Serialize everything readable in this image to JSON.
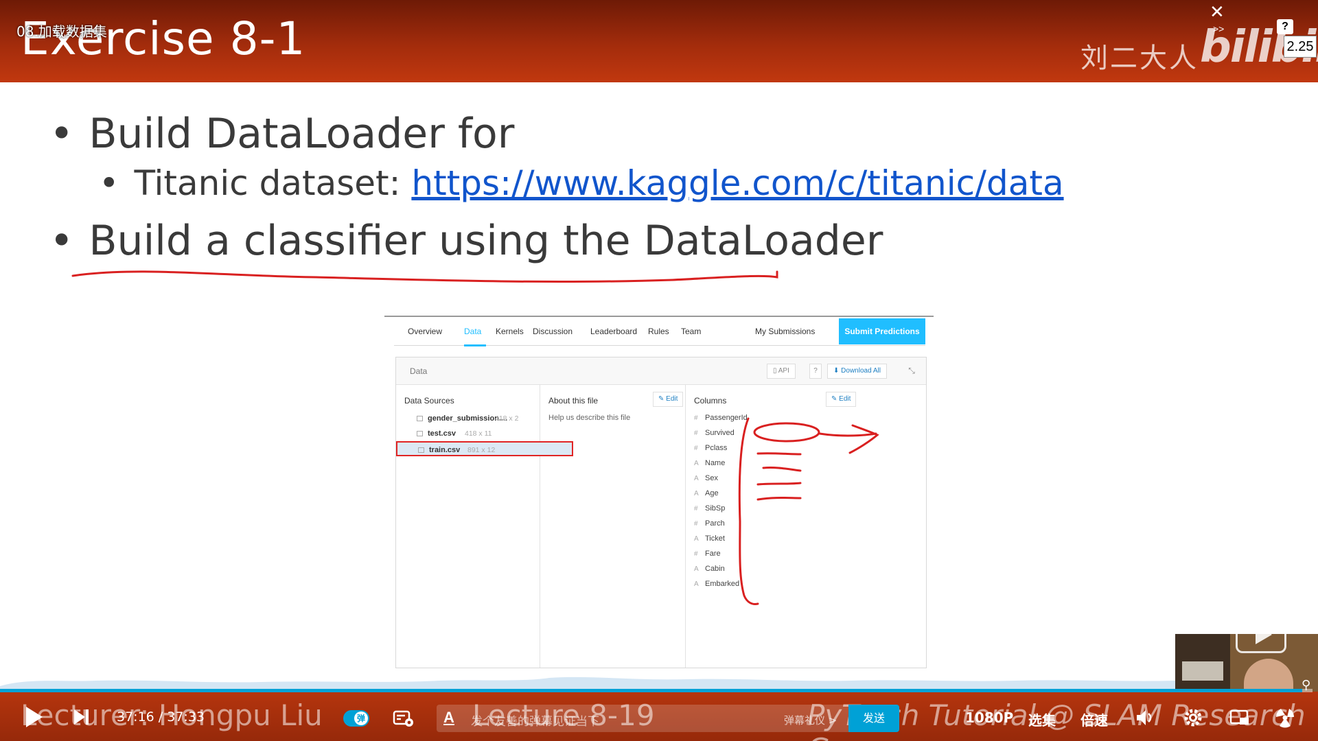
{
  "player": {
    "video_title": "08.加载数据集",
    "speed_badge": "2.25",
    "watermark_author": "刘二大人",
    "watermark_logo": "bilibili",
    "close_symbol": "✕",
    "ff_symbol": ">>",
    "help_symbol": "?",
    "time_current": "37:16",
    "time_separator": " / ",
    "time_total": "37:33",
    "progress_fraction": 0.992,
    "danmaku_toggle_symbol": "弹",
    "danmaku_font_symbol": "A",
    "danmaku_placeholder": "发个友善的弹幕见证当下",
    "danmaku_etiquette": "弹幕礼仪 >",
    "send_label": "发送",
    "quality_label": "1080P",
    "episodes_label": "选集",
    "speed_label": "倍速",
    "accent_color": "#00a1d6"
  },
  "slide": {
    "title": "Exercise 8-1",
    "bullet1": "Build DataLoader for",
    "bullet1_sub_prefix": "Titanic dataset: ",
    "bullet1_sub_link": "https://www.kaggle.com/c/titanic/data",
    "bullet2": "Build a classifier using the DataLoader",
    "bullet_symbol": "•",
    "footer_lecturer": "Lecturer: Hongpu Liu",
    "footer_lecture": "Lecture 8-19",
    "footer_tutorial": "PyTorch Tutorial @ SLAM Research Group",
    "header_color": "#b3330d"
  },
  "kaggle": {
    "tabs": [
      "Overview",
      "Data",
      "Kernels",
      "Discussion",
      "Leaderboard",
      "Rules",
      "Team"
    ],
    "active_tab": "Data",
    "my_submissions": "My Submissions",
    "submit_predictions": "Submit Predictions",
    "data_title": "Data",
    "api_label": "API",
    "help_label": "?",
    "download_all": "Download All",
    "data_sources_title": "Data Sources",
    "files": [
      {
        "name": "gender_submission....",
        "dims": "418 x 2"
      },
      {
        "name": "test.csv",
        "dims": "418 x 11"
      },
      {
        "name": "train.csv",
        "dims": "891 x 12"
      }
    ],
    "selected_file": "train.csv",
    "about_title": "About this file",
    "about_desc": "Help us describe this file",
    "edit_label": "Edit",
    "columns_title": "Columns",
    "columns": [
      {
        "type": "#",
        "name": "PassengerId"
      },
      {
        "type": "#",
        "name": "Survived"
      },
      {
        "type": "#",
        "name": "Pclass"
      },
      {
        "type": "A",
        "name": "Name"
      },
      {
        "type": "A",
        "name": "Sex"
      },
      {
        "type": "A",
        "name": "Age"
      },
      {
        "type": "#",
        "name": "SibSp"
      },
      {
        "type": "#",
        "name": "Parch"
      },
      {
        "type": "A",
        "name": "Ticket"
      },
      {
        "type": "#",
        "name": "Fare"
      },
      {
        "type": "A",
        "name": "Cabin"
      },
      {
        "type": "A",
        "name": "Embarked"
      }
    ],
    "accent_color": "#20beff"
  }
}
